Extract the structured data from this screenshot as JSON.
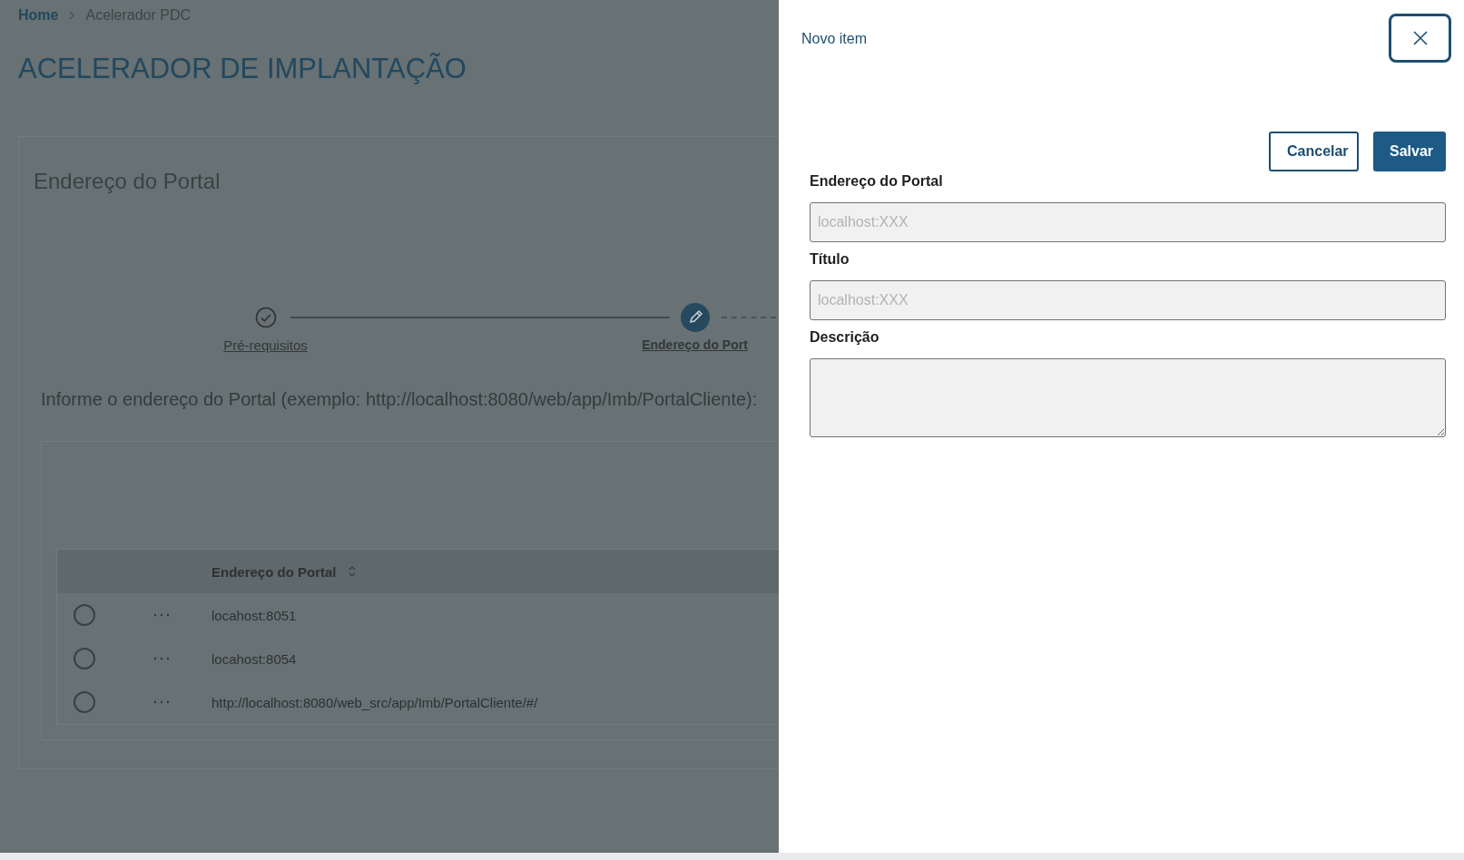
{
  "breadcrumb": [
    {
      "label": "Home",
      "kind": "link"
    },
    {
      "label": "Acelerador PDC",
      "kind": "current"
    }
  ],
  "page_title": "ACELERADOR DE IMPLANTAÇÃO",
  "card": {
    "title": "Endereço do Portal",
    "steps": [
      {
        "label": "Pré-requisitos",
        "done": true,
        "current": false
      },
      {
        "label": "Endereço do Port",
        "done": false,
        "current": true
      }
    ],
    "instruction": "Informe o endereço do Portal (exemplo: http://localhost:8080/web/app/Imb/PortalCliente):",
    "table": {
      "columns": [
        "Endereço do Portal"
      ],
      "rows": [
        {
          "value": "locahost:8051",
          "selected": false
        },
        {
          "value": "locahost:8054",
          "selected": false
        },
        {
          "value": "http://localhost:8080/web_src/app/Imb/PortalCliente/#/",
          "selected": false
        }
      ]
    }
  },
  "panel": {
    "title": "Novo item",
    "buttons": [
      {
        "label": "Cancelar",
        "kind": "secondary"
      },
      {
        "label": "Salvar",
        "kind": "primary"
      }
    ],
    "fields": [
      {
        "label": "Endereço do Portal",
        "placeholder": "localhost:XXX",
        "kind": "input"
      },
      {
        "label": "Título",
        "placeholder": "localhost:XXX",
        "kind": "input"
      },
      {
        "label": "Descrição",
        "kind": "textarea"
      }
    ]
  }
}
